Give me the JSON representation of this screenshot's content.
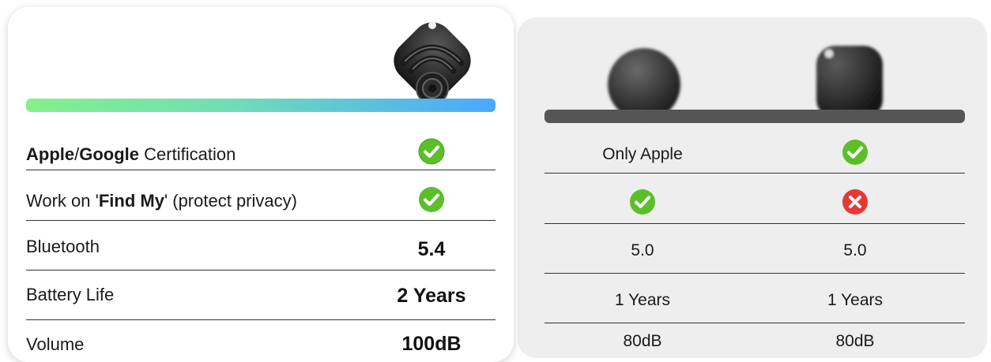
{
  "rows": {
    "certification": {
      "label_bold_1": "Apple",
      "label_sep": "/",
      "label_bold_2": "Google",
      "label_rest": " Certification",
      "ours": "check-icon",
      "comp1": "Only Apple",
      "comp2": "check-icon"
    },
    "find_my": {
      "label_pre": "Work on '",
      "label_bold": "Find My",
      "label_post": "' (protect privacy)",
      "ours": "check-icon",
      "comp1": "check-icon",
      "comp2": "cross-icon"
    },
    "bluetooth": {
      "label": "Bluetooth",
      "ours": "5.4",
      "comp1": "5.0",
      "comp2": "5.0"
    },
    "battery": {
      "label": "Battery Life",
      "ours": "2 Years",
      "comp1": "1 Years",
      "comp2": "1 Years"
    },
    "volume": {
      "label": "Volume",
      "ours": "100dB",
      "comp1": "80dB",
      "comp2": "80dB"
    }
  },
  "colors": {
    "check": "#5cbf2a",
    "cross": "#e53935",
    "gradient_start": "#86f08a",
    "gradient_end": "#4aa8ff",
    "competitor_bar": "#555555"
  },
  "products": [
    "featured-tracker-image",
    "round-tracker-image",
    "square-tracker-image"
  ]
}
